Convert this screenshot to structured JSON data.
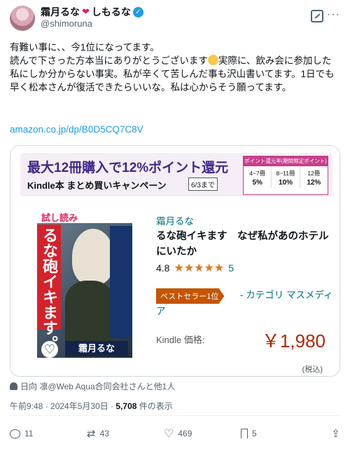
{
  "user": {
    "display_name": "霜月るな",
    "display_name_suffix": "しもるな",
    "handle": "@shimoruna"
  },
  "tweet": {
    "text_line1": "有難い事に、、今1位になってます。",
    "text_line2a": "読んで下さった方本当にありがとうございます",
    "text_line2b": "実際に、飲み会に参加した私にしか分からない事実。私が辛くて苦しんだ事も沢山書いてます。1日でも早く松本さんが復活できたらいいな。私は心からそう願ってます。",
    "link": "amazon.co.jp/dp/B0D5CQ7C8V"
  },
  "banner": {
    "title": "最大12冊購入で12%ポイント還元",
    "subtitle": "Kindle本 まとめ買いキャンペーン",
    "date": "6/3まで",
    "rates_header": "ポイント還元率(期間限定ポイント)",
    "rates": [
      {
        "range": "4~7冊",
        "pct": "5%"
      },
      {
        "range": "8~11冊",
        "pct": "10%"
      },
      {
        "range": "12冊",
        "pct": "12%"
      }
    ]
  },
  "cover": {
    "tag": "試し読み",
    "title": "るな砲イキます。",
    "author": "霜月るな"
  },
  "product": {
    "author": "霜月るな",
    "title": "るな砲イキます　なぜ私があのホテルにいたか",
    "rating": "4.8",
    "rating_value": 4.8,
    "stars": "★★★★★",
    "rating_count": "5",
    "badge": "ベストセラー1位",
    "category": "- カテゴリ マスメディア",
    "price_label": "Kindle 価格:",
    "price": "￥1,980",
    "tax": "(税込)"
  },
  "tagged": "日向 凛@Web Aqua合同会社さんと他1人",
  "meta": {
    "time": "午前9:48 · 2024年5月30日 · ",
    "views": "5,708",
    "views_suffix": " 件の表示"
  },
  "actions": {
    "replies": "11",
    "retweets": "43",
    "likes": "469",
    "bookmarks": "5"
  }
}
